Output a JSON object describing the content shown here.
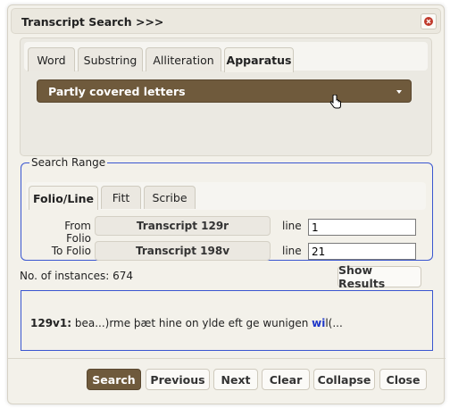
{
  "dialog": {
    "title": "Transcript Search >>>",
    "close_icon": "close-x-icon",
    "colors": {
      "accent": "#6f5a3c",
      "highlight": "#1d36c9",
      "range_border": "#3a56d0"
    }
  },
  "search_tabs": [
    {
      "label": "Word"
    },
    {
      "label": "Substring"
    },
    {
      "label": "Alliteration"
    },
    {
      "label": "Apparatus"
    }
  ],
  "active_search_tab": "Apparatus",
  "apparatus": {
    "selected": "Partly covered letters",
    "caret_icon": "caret-down-icon"
  },
  "search_range": {
    "legend": "Search Range",
    "tabs": [
      {
        "label": "Folio/Line"
      },
      {
        "label": "Fitt"
      },
      {
        "label": "Scribe"
      }
    ],
    "active_tab": "Folio/Line",
    "from": {
      "label": "From Folio",
      "folio": "Transcript 129r",
      "line_label": "line",
      "line": "1"
    },
    "to": {
      "label": "To Folio",
      "folio": "Transcript 198v",
      "line_label": "line",
      "line": "21"
    }
  },
  "instances_text": "No. of instances: 674",
  "show_results_label": "Show Results",
  "result": {
    "ref": "129v1:",
    "text_before": " bea...)rme þæt hine on ylde eft ge wunigen ",
    "highlight": "wi",
    "text_after": "l(..."
  },
  "footer_buttons": {
    "search": "Search",
    "previous": "Previous",
    "next": "Next",
    "clear": "Clear",
    "collapse": "Collapse",
    "close": "Close"
  }
}
